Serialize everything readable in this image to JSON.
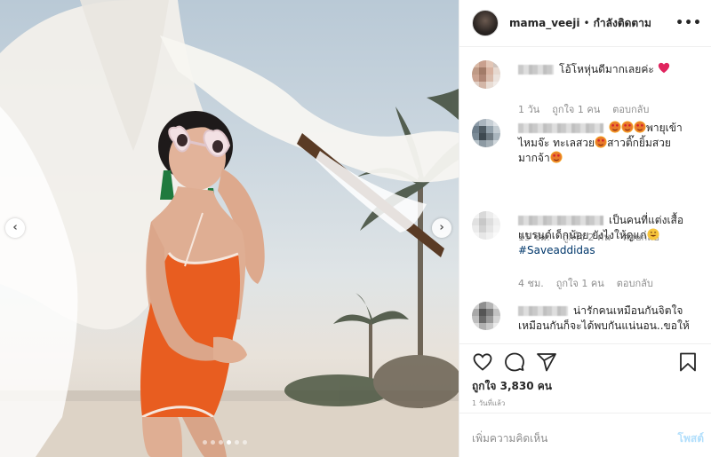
{
  "post": {
    "username": "mama_veeji",
    "separator": "•",
    "follow_state": "กำลังติดตาม",
    "more_label": "•••",
    "carousel": {
      "count": 6,
      "active": 3
    }
  },
  "comments": [
    {
      "text": "โอ้โหหุ่นดีมากเลยค่ะ",
      "time": "1 วัน",
      "likes": "ถูกใจ 1 คน",
      "reply": "ตอบกลับ"
    },
    {
      "text_a": "พายุเข้า",
      "text_b": "ไหมจ๊ะ ทะเลสวย",
      "text_c": "สาวติ๊กยิ้มสวย",
      "text_d": "มากจ้า",
      "time": "15 ชม.",
      "likes": "ถูกใจ 2 คน",
      "reply": "ตอบกลับ"
    },
    {
      "text": "เป็นคนที่แต่งเสื้อ แบรนด์เด็กน้อย ยังไงให้ดูแก่",
      "hashtag": "#Saveaddidas",
      "time": "4 ชม.",
      "likes": "ถูกใจ 1 คน",
      "reply": "ตอบกลับ"
    },
    {
      "text": "น่ารักคนเหมือนกันจิตใจ เหมือนกันก็จะได้พบกันแน่นอน..ขอให้"
    }
  ],
  "actions": {
    "likes_count": "ถูกใจ 3,830 คน",
    "posted_ago": "1 วันที่แล้ว"
  },
  "composer": {
    "placeholder": "เพิ่มความคิดเห็น",
    "post_label": "โพสต์"
  },
  "colors": {
    "link": "#00376b",
    "muted": "#8e8e8e",
    "post_disabled": "#b2dffc"
  }
}
